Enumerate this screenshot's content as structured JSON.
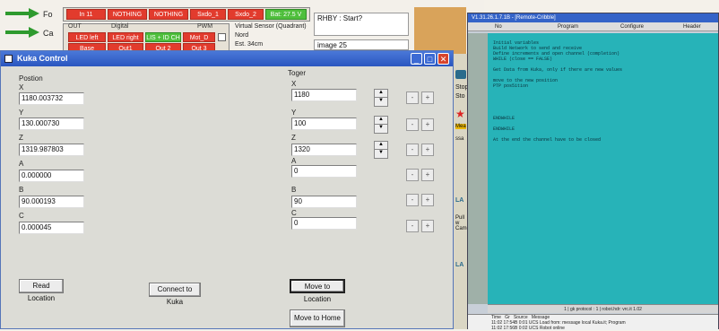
{
  "background_app": {
    "side_labels": [
      "Fo",
      "Ca"
    ],
    "top_cells": [
      {
        "text": "In 11",
        "color": "red"
      },
      {
        "text": "NOTHING",
        "color": "red"
      },
      {
        "text": "NOTHING",
        "color": "red"
      },
      {
        "text": "Sxdo_1",
        "color": "red"
      },
      {
        "text": "Sxdo_2",
        "color": "red"
      },
      {
        "text": "Bat: 27.5 V",
        "color": "green"
      }
    ],
    "out_label": "OUT",
    "digital_label": "Digital",
    "pwm_label": "PWM",
    "row2_cells": [
      {
        "text": "LED left",
        "color": "red"
      },
      {
        "text": "LED right",
        "color": "red"
      },
      {
        "text": "LIS + ID CH",
        "color": "green"
      },
      {
        "text": "Mot_D",
        "color": "red"
      }
    ],
    "row3_cells": [
      {
        "text": "Base",
        "color": "red"
      },
      {
        "text": "Out1",
        "color": "red"
      },
      {
        "text": "Out 2",
        "color": "red"
      },
      {
        "text": "Out 3",
        "color": "red"
      }
    ],
    "sensor_title": "Virtual Sensor (Quadrant)",
    "sensor_value": "Nord",
    "sensor_dist": "Est. 34cm",
    "rhby_text": "RHBY : Start?",
    "image_text": "image 25",
    "peek_labels": [
      "Stop",
      "Sto",
      "Mea",
      "ssa",
      "Pull w",
      "Came",
      "LA",
      "LA"
    ]
  },
  "kuka": {
    "title": "Kuka Control",
    "position_label": "Postion",
    "target_label": "Toger",
    "axes": [
      "X",
      "Y",
      "Z",
      "A",
      "B",
      "C"
    ],
    "position_values": [
      "1180.003732",
      "130.000730",
      "1319.987803",
      "0.000000",
      "90.000193",
      "0.000045"
    ],
    "target_values": [
      "1180",
      "100",
      "1320",
      "0",
      "90",
      "0"
    ],
    "read_location": "Read Location",
    "connect": "Connect to Kuka",
    "move_location": "Move to Location",
    "move_home": "Move to Home",
    "step_minus": "-",
    "step_plus": "+",
    "up_arrow": "▲",
    "down_arrow": "▼"
  },
  "editor_window": {
    "title": "V1.31.26.1.7.1B - [Remote-Cribble]",
    "columns": [
      "No",
      "Program",
      "Configure",
      "Header"
    ],
    "code_lines": [
      "Initial variables",
      "Build Network to send and receive",
      "Define increments and open channel (completion)",
      "WHILE (close == FALSE)",
      "",
      "Get Data from Kuka, only if there are new values",
      "",
      "move to the new position",
      "PTP pos5ition",
      "",
      "",
      "",
      "",
      "",
      "ENDWHILE",
      "",
      "ENDWHILE",
      "",
      "At the end the channel have to be closed"
    ],
    "status_text": "1 | gk protocol : 1 | robot.hdr: vrc.it 1.02",
    "log_header": [
      "Time",
      "Gr",
      "Source",
      "Message"
    ],
    "log_rows": [
      "11:02  17:54B   0:01   UCS   Load from: message local Kuka.it; Program",
      "11:02  17:56B   0:02   UCS   Robot online"
    ]
  }
}
